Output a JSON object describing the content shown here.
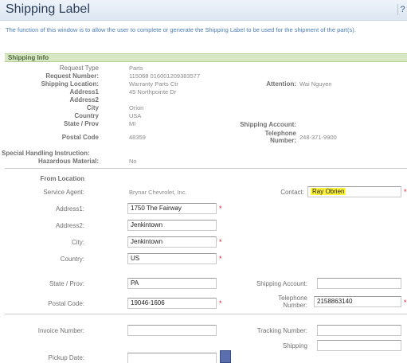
{
  "window": {
    "title": "Shipping Label",
    "help_label": "?"
  },
  "description": "The function of this window is to allow the user to complete or generate the Shipping Label to be used for the shipment of the part(s).",
  "shipping_info": {
    "section_title": "Shipping Info",
    "request_type_label": "Request Type",
    "request_type": "Parts",
    "request_number_label": "Request Number:",
    "request_number": "115068 016001209383577",
    "shipping_location_label": "Shipping Location:",
    "shipping_location": "Warranty Parts Ctr",
    "attention_label": "Attention:",
    "attention": "Wai Nguyen",
    "address1_label": "Address1",
    "address1": "45 Northpointe Dr",
    "address2_label": "Address2",
    "address2": "",
    "city_label": "City",
    "city": "Orion",
    "country_label": "Country",
    "country": "USA",
    "state_label": "State / Prov",
    "state": "MI",
    "shipping_account_label": "Shipping Account:",
    "postal_label": "Postal Code",
    "postal": "48359",
    "telephone_label_1": "Telephone",
    "telephone_label_2": "Number:",
    "telephone": "248-371-9900",
    "special_label": "Special Handling Instruction:",
    "hazardous_label": "Hazardous Material:",
    "hazardous": "No"
  },
  "from_location": {
    "section_label": "From Location",
    "service_agent_label": "Service Agent:",
    "service_agent": "Brynar Chevrolet, Inc.",
    "contact_label": "Contact:",
    "contact": "Ray Obrien",
    "address1_label": "Address1:",
    "address1": "1750 The Fairway",
    "address2_label": "Address2:",
    "address2": "Jenkintown",
    "city_label": "City:",
    "city": "Jenkintown",
    "country_label": "Country:",
    "country": "US",
    "state_label": "State / Prov:",
    "state": "PA",
    "shipping_account_label": "Shipping Account:",
    "shipping_account": "",
    "postal_label": "Postal Code:",
    "postal": "19046-1606",
    "telephone_label_1": "Telephone",
    "telephone_label_2": "Number:",
    "telephone": "2158863140",
    "required_mark": "*"
  },
  "bottom": {
    "invoice_label": "Invoice Number:",
    "invoice": "",
    "tracking_label": "Tracking Number:",
    "tracking": "",
    "pickup_label": "Pickup Date:",
    "pickup": "",
    "shipping_label": "Shipping"
  }
}
